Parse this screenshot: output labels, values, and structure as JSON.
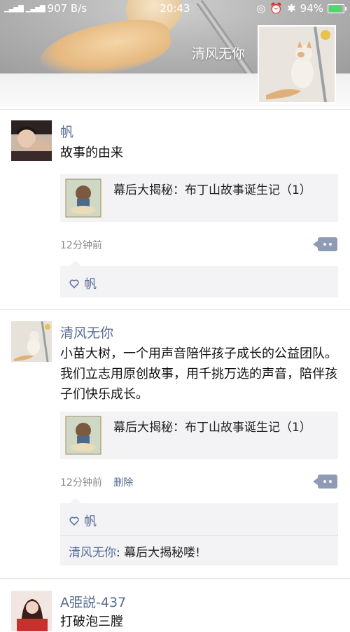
{
  "status_bar": {
    "network": "907 B/s",
    "time": "20:43",
    "battery": "94%",
    "battery_level": 0.94
  },
  "cover": {
    "username": "清风无你"
  },
  "posts": [
    {
      "name": "帆",
      "text": "故事的由来",
      "link_title": "幕后大揭秘：布丁山故事诞生记（1）",
      "time": "12分钟前",
      "delete_label": "",
      "likes": "帆",
      "comments": []
    },
    {
      "name": "清风无你",
      "text": "小苗大树，一个用声音陪伴孩子成长的公益团队。我们立志用原创故事，用千挑万选的声音，陪伴孩子们快乐成长。",
      "link_title": "幕后大揭秘：布丁山故事诞生记（1）",
      "time": "12分钟前",
      "delete_label": "删除",
      "likes": "帆",
      "comments": [
        {
          "name": "清风无你",
          "separator": ": ",
          "text": "幕后大揭秘喽!"
        }
      ]
    },
    {
      "name": "A弫説-437",
      "text": "打破泡三膛"
    }
  ],
  "icons": {
    "like": "heart-outline-icon",
    "more": "more-dots-icon"
  },
  "colors": {
    "name_link": "#576b95",
    "more_button": "#8f9bb6",
    "card_bg": "#f3f3f5"
  }
}
